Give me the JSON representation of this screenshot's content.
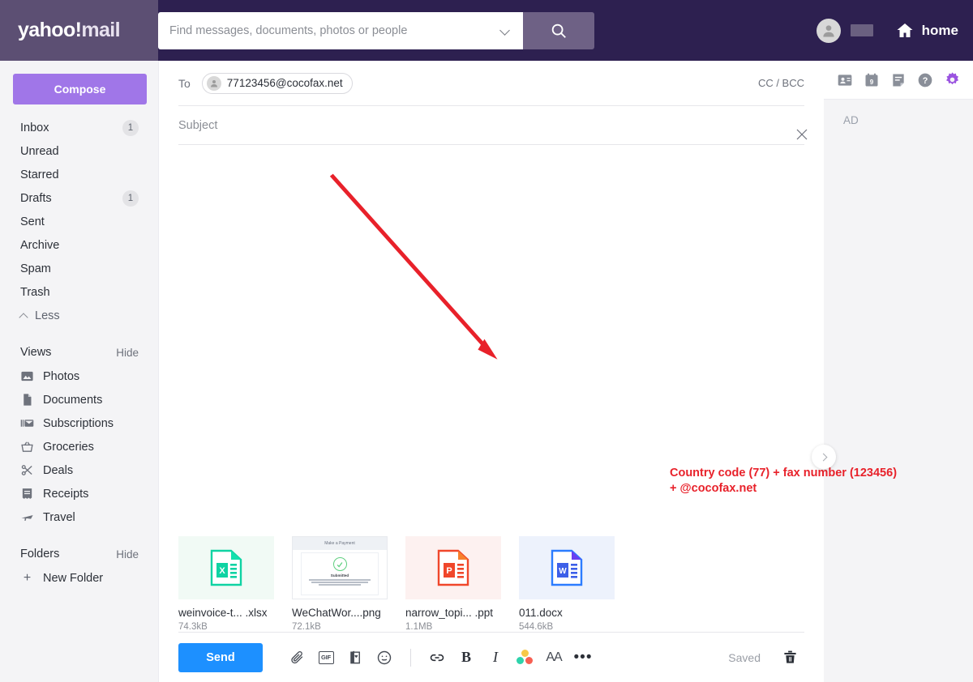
{
  "header": {
    "logo_yahoo": "yahoo",
    "logo_bang": "!",
    "logo_mail": "mail",
    "search_placeholder": "Find messages, documents, photos or people",
    "search_value": "",
    "home_label": "home",
    "brand_purple": "#2d2050",
    "logo_bg": "#5c4f73"
  },
  "sidebar": {
    "compose_label": "Compose",
    "folders": [
      {
        "label": "Inbox",
        "badge": "1"
      },
      {
        "label": "Unread",
        "badge": ""
      },
      {
        "label": "Starred",
        "badge": ""
      },
      {
        "label": "Drafts",
        "badge": "1"
      },
      {
        "label": "Sent",
        "badge": ""
      },
      {
        "label": "Archive",
        "badge": ""
      },
      {
        "label": "Spam",
        "badge": ""
      },
      {
        "label": "Trash",
        "badge": ""
      }
    ],
    "less_label": "Less",
    "views_title": "Views",
    "views_action": "Hide",
    "views": [
      {
        "label": "Photos",
        "icon": "photos-icon"
      },
      {
        "label": "Documents",
        "icon": "documents-icon"
      },
      {
        "label": "Subscriptions",
        "icon": "subscriptions-icon"
      },
      {
        "label": "Groceries",
        "icon": "groceries-icon"
      },
      {
        "label": "Deals",
        "icon": "deals-icon"
      },
      {
        "label": "Receipts",
        "icon": "receipts-icon"
      },
      {
        "label": "Travel",
        "icon": "travel-icon"
      }
    ],
    "folders_title": "Folders",
    "folders_action": "Hide",
    "new_folder_label": "New Folder",
    "compose_color": "#a076e8"
  },
  "compose": {
    "to_label": "To",
    "recipient": "77123456@cocofax.net",
    "ccbcc_label": "CC / BCC",
    "subject_placeholder": "Subject",
    "subject_value": "",
    "body_value": "",
    "annotation_line1": "Country code (77) + fax number (123456)",
    "annotation_line2": "+ @cocofax.net",
    "annotation_color": "#e8212a"
  },
  "attachments": [
    {
      "name": "weinvoice-t... .xlsx",
      "size": "74.3kB",
      "kind": "xlsx",
      "bg": "#f1faf5",
      "icon_color": "#0fd3a3"
    },
    {
      "name": "WeChatWor....png",
      "size": "72.1kB",
      "kind": "png-preview",
      "bg": "#ffffff",
      "preview_header": "Make a Payment",
      "preview_status": "Submitted"
    },
    {
      "name": "narrow_topi... .ppt",
      "size": "1.1MB",
      "kind": "ppt",
      "bg": "#fdf1f0",
      "icon_color": "#f0472b"
    },
    {
      "name": "011.docx",
      "size": "544.6kB",
      "kind": "docx",
      "bg": "#edf2fc",
      "icon_color": "#2b7cff"
    }
  ],
  "toolbar": {
    "send_label": "Send",
    "send_color": "#1d90ff",
    "tools": [
      {
        "name": "attach-icon"
      },
      {
        "name": "gif-icon",
        "label": "GIF"
      },
      {
        "name": "greeting-card-icon"
      },
      {
        "name": "emoji-icon"
      }
    ],
    "format_tools": [
      {
        "name": "link-icon"
      },
      {
        "name": "bold-icon",
        "label": "B"
      },
      {
        "name": "italic-icon",
        "label": "I"
      },
      {
        "name": "text-color-icon"
      },
      {
        "name": "font-size-icon",
        "label": "AA"
      },
      {
        "name": "more-options-icon",
        "label": "•••"
      }
    ],
    "saved_label": "Saved",
    "color_dot_1": "#f7c948",
    "color_dot_2": "#2ed3ab",
    "color_dot_3": "#f75f52"
  },
  "rail": {
    "icons": [
      {
        "name": "contacts-icon"
      },
      {
        "name": "calendar-icon",
        "badge": "9"
      },
      {
        "name": "notepad-icon"
      },
      {
        "name": "help-icon"
      },
      {
        "name": "settings-gear-icon"
      }
    ],
    "ad_label": "AD",
    "gear_color": "#9a53e0"
  }
}
